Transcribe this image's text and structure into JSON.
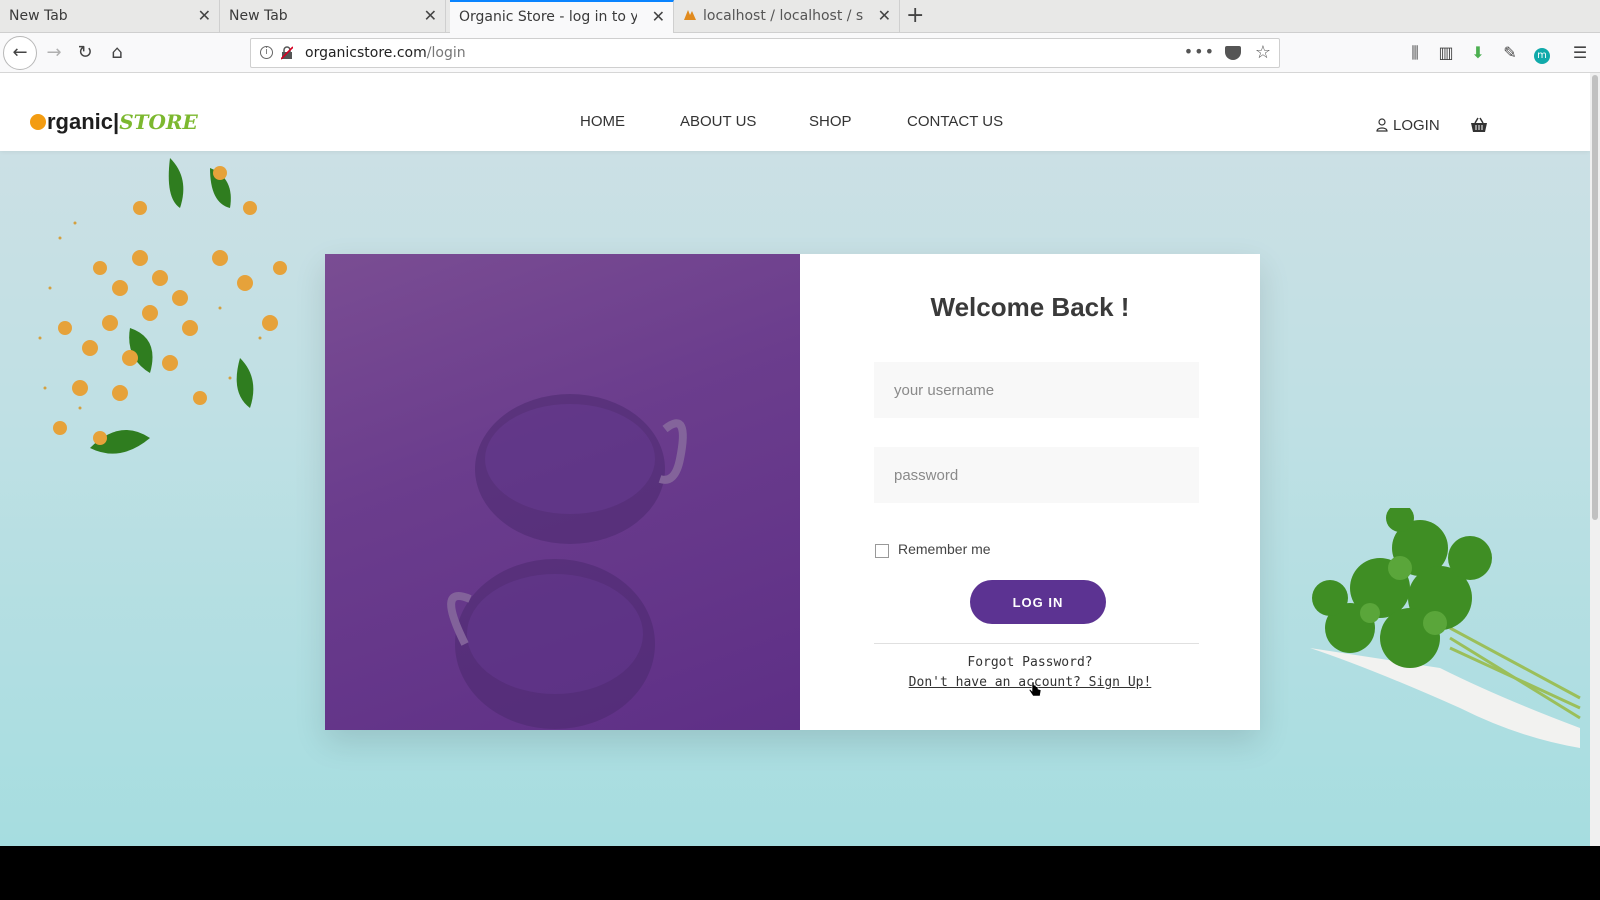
{
  "browser": {
    "tabs": [
      {
        "title": "New Tab",
        "active": false
      },
      {
        "title": "New Tab",
        "active": false
      },
      {
        "title": "Organic Store - log in to your",
        "active": true
      },
      {
        "title": "localhost / localhost / st",
        "active": false
      }
    ],
    "url_domain": "organicstore.com",
    "url_path": "/login"
  },
  "site": {
    "logo_main": "rganic|",
    "logo_store": "STORE",
    "nav": [
      "HOME",
      "ABOUT US",
      "SHOP",
      "CONTACT US"
    ],
    "login_label": "LOGIN"
  },
  "login": {
    "heading": "Welcome Back !",
    "username_placeholder": "your username",
    "password_placeholder": "password",
    "remember_label": "Remember me",
    "button_label": "LOG IN",
    "forgot_label": "Forgot Password?",
    "signup_label": "Don't have an account? Sign Up!"
  },
  "colors": {
    "accent": "#5c3392",
    "brand_green": "#7cb82f",
    "brand_orange": "#f39c12"
  }
}
